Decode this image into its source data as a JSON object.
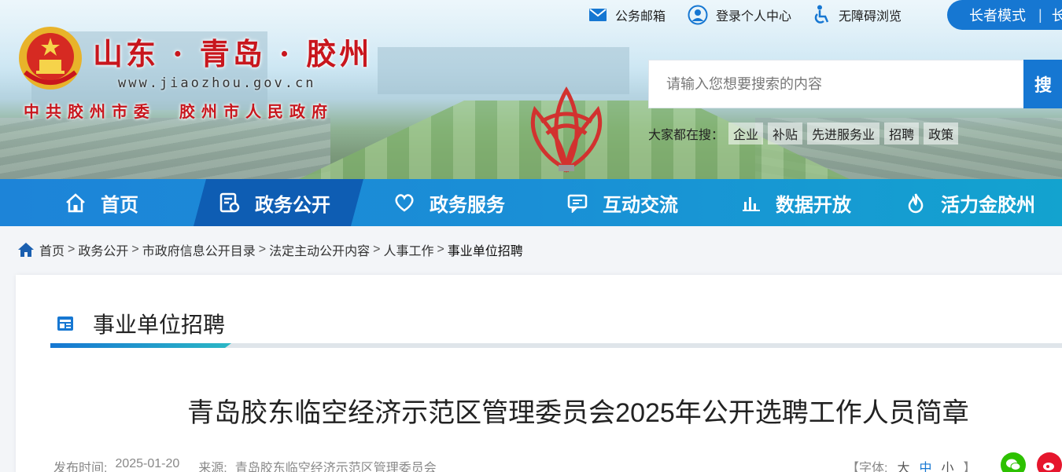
{
  "header": {
    "logo_title": "山东 · 青岛 · 胶州",
    "logo_url": "www.jiaozhou.gov.cn",
    "logo_sub_left": "中共胶州市委",
    "logo_sub_right": "胶州市人民政府",
    "toplinks": [
      {
        "label": "公务邮箱",
        "icon": "mail-icon"
      },
      {
        "label": "登录个人中心",
        "icon": "user-icon"
      },
      {
        "label": "无障碍浏览",
        "icon": "accessibility-icon"
      }
    ],
    "elder_mode": "长者模式",
    "elder_sep": "|",
    "elder_next": "长",
    "search_placeholder": "请输入您想要搜索的内容",
    "search_button": "搜",
    "hot_label": "大家都在搜：",
    "hot_words": [
      "企业",
      "补贴",
      "先进服务业",
      "招聘",
      "政策"
    ]
  },
  "nav": {
    "items": [
      {
        "label": "首页",
        "icon": "home-icon"
      },
      {
        "label": "政务公开",
        "icon": "document-icon",
        "active": true
      },
      {
        "label": "政务服务",
        "icon": "heart-icon"
      },
      {
        "label": "互动交流",
        "icon": "chat-icon"
      },
      {
        "label": "数据开放",
        "icon": "bar-chart-icon"
      },
      {
        "label": "活力金胶州",
        "icon": "flame-icon"
      }
    ]
  },
  "breadcrumb": {
    "items": [
      "首页",
      "政务公开",
      "市政府信息公开目录",
      "法定主动公开内容",
      "人事工作",
      "事业单位招聘"
    ],
    "separator": ">"
  },
  "section": {
    "title": "事业单位招聘"
  },
  "article": {
    "title": "青岛胶东临空经济示范区管理委员会2025年公开选聘工作人员简章",
    "date_label": "发布时间:",
    "date": "2025-01-20",
    "source_label": "来源:",
    "source": "青岛胶东临空经济示范区管理委员会",
    "font_label": "【字体:",
    "font_large": "大",
    "font_medium": "中",
    "font_small": "小",
    "font_close": "】"
  },
  "colors": {
    "brand_blue": "#1677d2",
    "brand_red": "#c8161d",
    "wechat_green": "#2dc100",
    "weibo_red": "#e6162d"
  }
}
